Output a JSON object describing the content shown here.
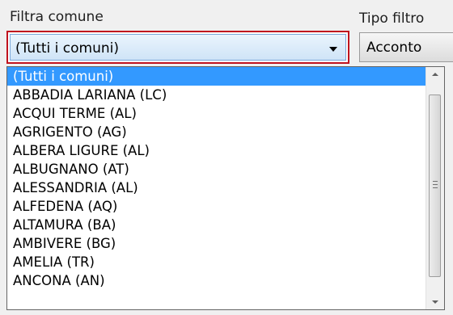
{
  "filters": {
    "comune_label": "Filtra comune",
    "comune_selected": "(Tutti i comuni)",
    "tipo_label": "Tipo filtro",
    "tipo_selected": "Acconto"
  },
  "dropdown": {
    "options": [
      "(Tutti i comuni)",
      "ABBADIA LARIANA (LC)",
      "ACQUI TERME (AL)",
      "AGRIGENTO (AG)",
      "ALBERA LIGURE (AL)",
      "ALBUGNANO (AT)",
      "ALESSANDRIA (AL)",
      "ALFEDENA (AQ)",
      "ALTAMURA (BA)",
      "AMBIVERE (BG)",
      "AMELIA (TR)",
      "ANCONA (AN)"
    ],
    "highlighted_index": 0
  },
  "icons": {
    "combo_arrow": "chevron-down-icon",
    "scroll_up": "scroll-up-arrow-icon",
    "scroll_down": "scroll-down-arrow-icon"
  },
  "colors": {
    "focus_border": "#c0121e",
    "highlight": "#3399ff"
  }
}
